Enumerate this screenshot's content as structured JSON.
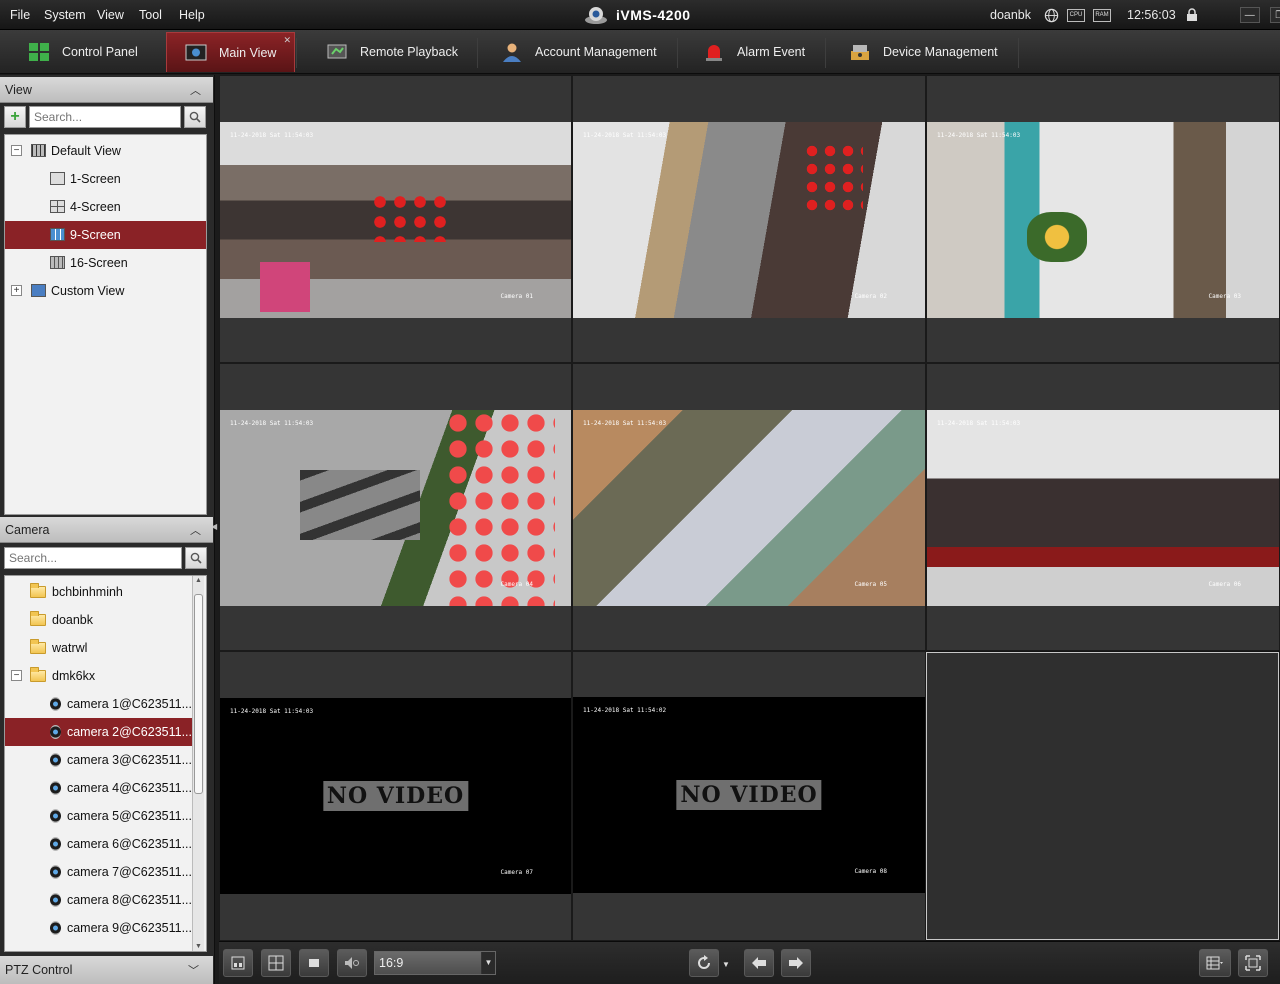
{
  "menu": [
    "File",
    "System",
    "View",
    "Tool",
    "Help"
  ],
  "app_title": "iVMS-4200",
  "user": "doanbk",
  "clock": "12:56:03",
  "indicators": {
    "cpu": "CPU",
    "ram": "RAM"
  },
  "tabs": [
    {
      "label": "Control Panel",
      "icon": "control-panel-icon",
      "active": false
    },
    {
      "label": "Main View",
      "icon": "main-view-icon",
      "active": true
    },
    {
      "label": "Remote Playback",
      "icon": "remote-playback-icon",
      "active": false
    },
    {
      "label": "Account Management",
      "icon": "account-icon",
      "active": false
    },
    {
      "label": "Alarm Event",
      "icon": "alarm-icon",
      "active": false
    },
    {
      "label": "Device Management",
      "icon": "device-icon",
      "active": false
    }
  ],
  "view_panel": {
    "title": "View",
    "search_placeholder": "Search...",
    "items": [
      {
        "label": "Default View",
        "level": 0,
        "expander": "−"
      },
      {
        "label": "1-Screen",
        "level": 1
      },
      {
        "label": "4-Screen",
        "level": 1
      },
      {
        "label": "9-Screen",
        "level": 1,
        "selected": true
      },
      {
        "label": "16-Screen",
        "level": 1
      },
      {
        "label": "Custom View",
        "level": 0,
        "expander": "+"
      }
    ]
  },
  "camera_panel": {
    "title": "Camera",
    "search_placeholder": "Search...",
    "items": [
      {
        "label": "bchbinhminh",
        "type": "folder"
      },
      {
        "label": "doanbk",
        "type": "folder"
      },
      {
        "label": "watrwl",
        "type": "folder"
      },
      {
        "label": "dmk6kx",
        "type": "folder",
        "expander": "−"
      },
      {
        "label": "camera 1@C623511...",
        "type": "camera"
      },
      {
        "label": "camera 2@C623511...",
        "type": "camera",
        "selected": true
      },
      {
        "label": "camera 3@C623511...",
        "type": "camera"
      },
      {
        "label": "camera 4@C623511...",
        "type": "camera"
      },
      {
        "label": "camera 5@C623511...",
        "type": "camera"
      },
      {
        "label": "camera 6@C623511...",
        "type": "camera"
      },
      {
        "label": "camera 7@C623511...",
        "type": "camera"
      },
      {
        "label": "camera 8@C623511...",
        "type": "camera"
      },
      {
        "label": "camera 9@C623511...",
        "type": "camera"
      }
    ]
  },
  "ptz": {
    "title": "PTZ Control"
  },
  "feeds": [
    {
      "osd_time": "11-24-2018 Sat 11:54:03",
      "osd_name": "Camera 01",
      "novideo": false,
      "scene": "store-front"
    },
    {
      "osd_time": "11-24-2018 Sat 11:54:03",
      "osd_name": "Camera 02",
      "novideo": false,
      "scene": "store-rack"
    },
    {
      "osd_time": "11-24-2018 Sat 11:54:03",
      "osd_name": "Camera 03",
      "novideo": false,
      "scene": "counter"
    },
    {
      "osd_time": "11-24-2018 Sat 11:54:03",
      "osd_name": "Camera 04",
      "novideo": false,
      "scene": "street"
    },
    {
      "osd_time": "11-24-2018 Sat 11:54:03",
      "osd_name": "Camera 05",
      "novideo": false,
      "scene": "storage"
    },
    {
      "osd_time": "11-24-2018 Sat 11:54:03",
      "osd_name": "Camera 06",
      "novideo": false,
      "scene": "store-aisle"
    },
    {
      "osd_time": "11-24-2018 Sat 11:54:03",
      "osd_name": "Camera 07",
      "novideo": true,
      "novideo_text": "NO VIDEO"
    },
    {
      "osd_time": "11-24-2018 Sat 11:54:02",
      "osd_name": "Camera 08",
      "novideo": true,
      "novideo_text": "NO VIDEO"
    },
    {
      "empty": true
    }
  ],
  "toolbar": {
    "aspect_ratio": "16:9"
  },
  "colors": {
    "accent": "#8a2226",
    "tab_active": "#7a1d20"
  }
}
